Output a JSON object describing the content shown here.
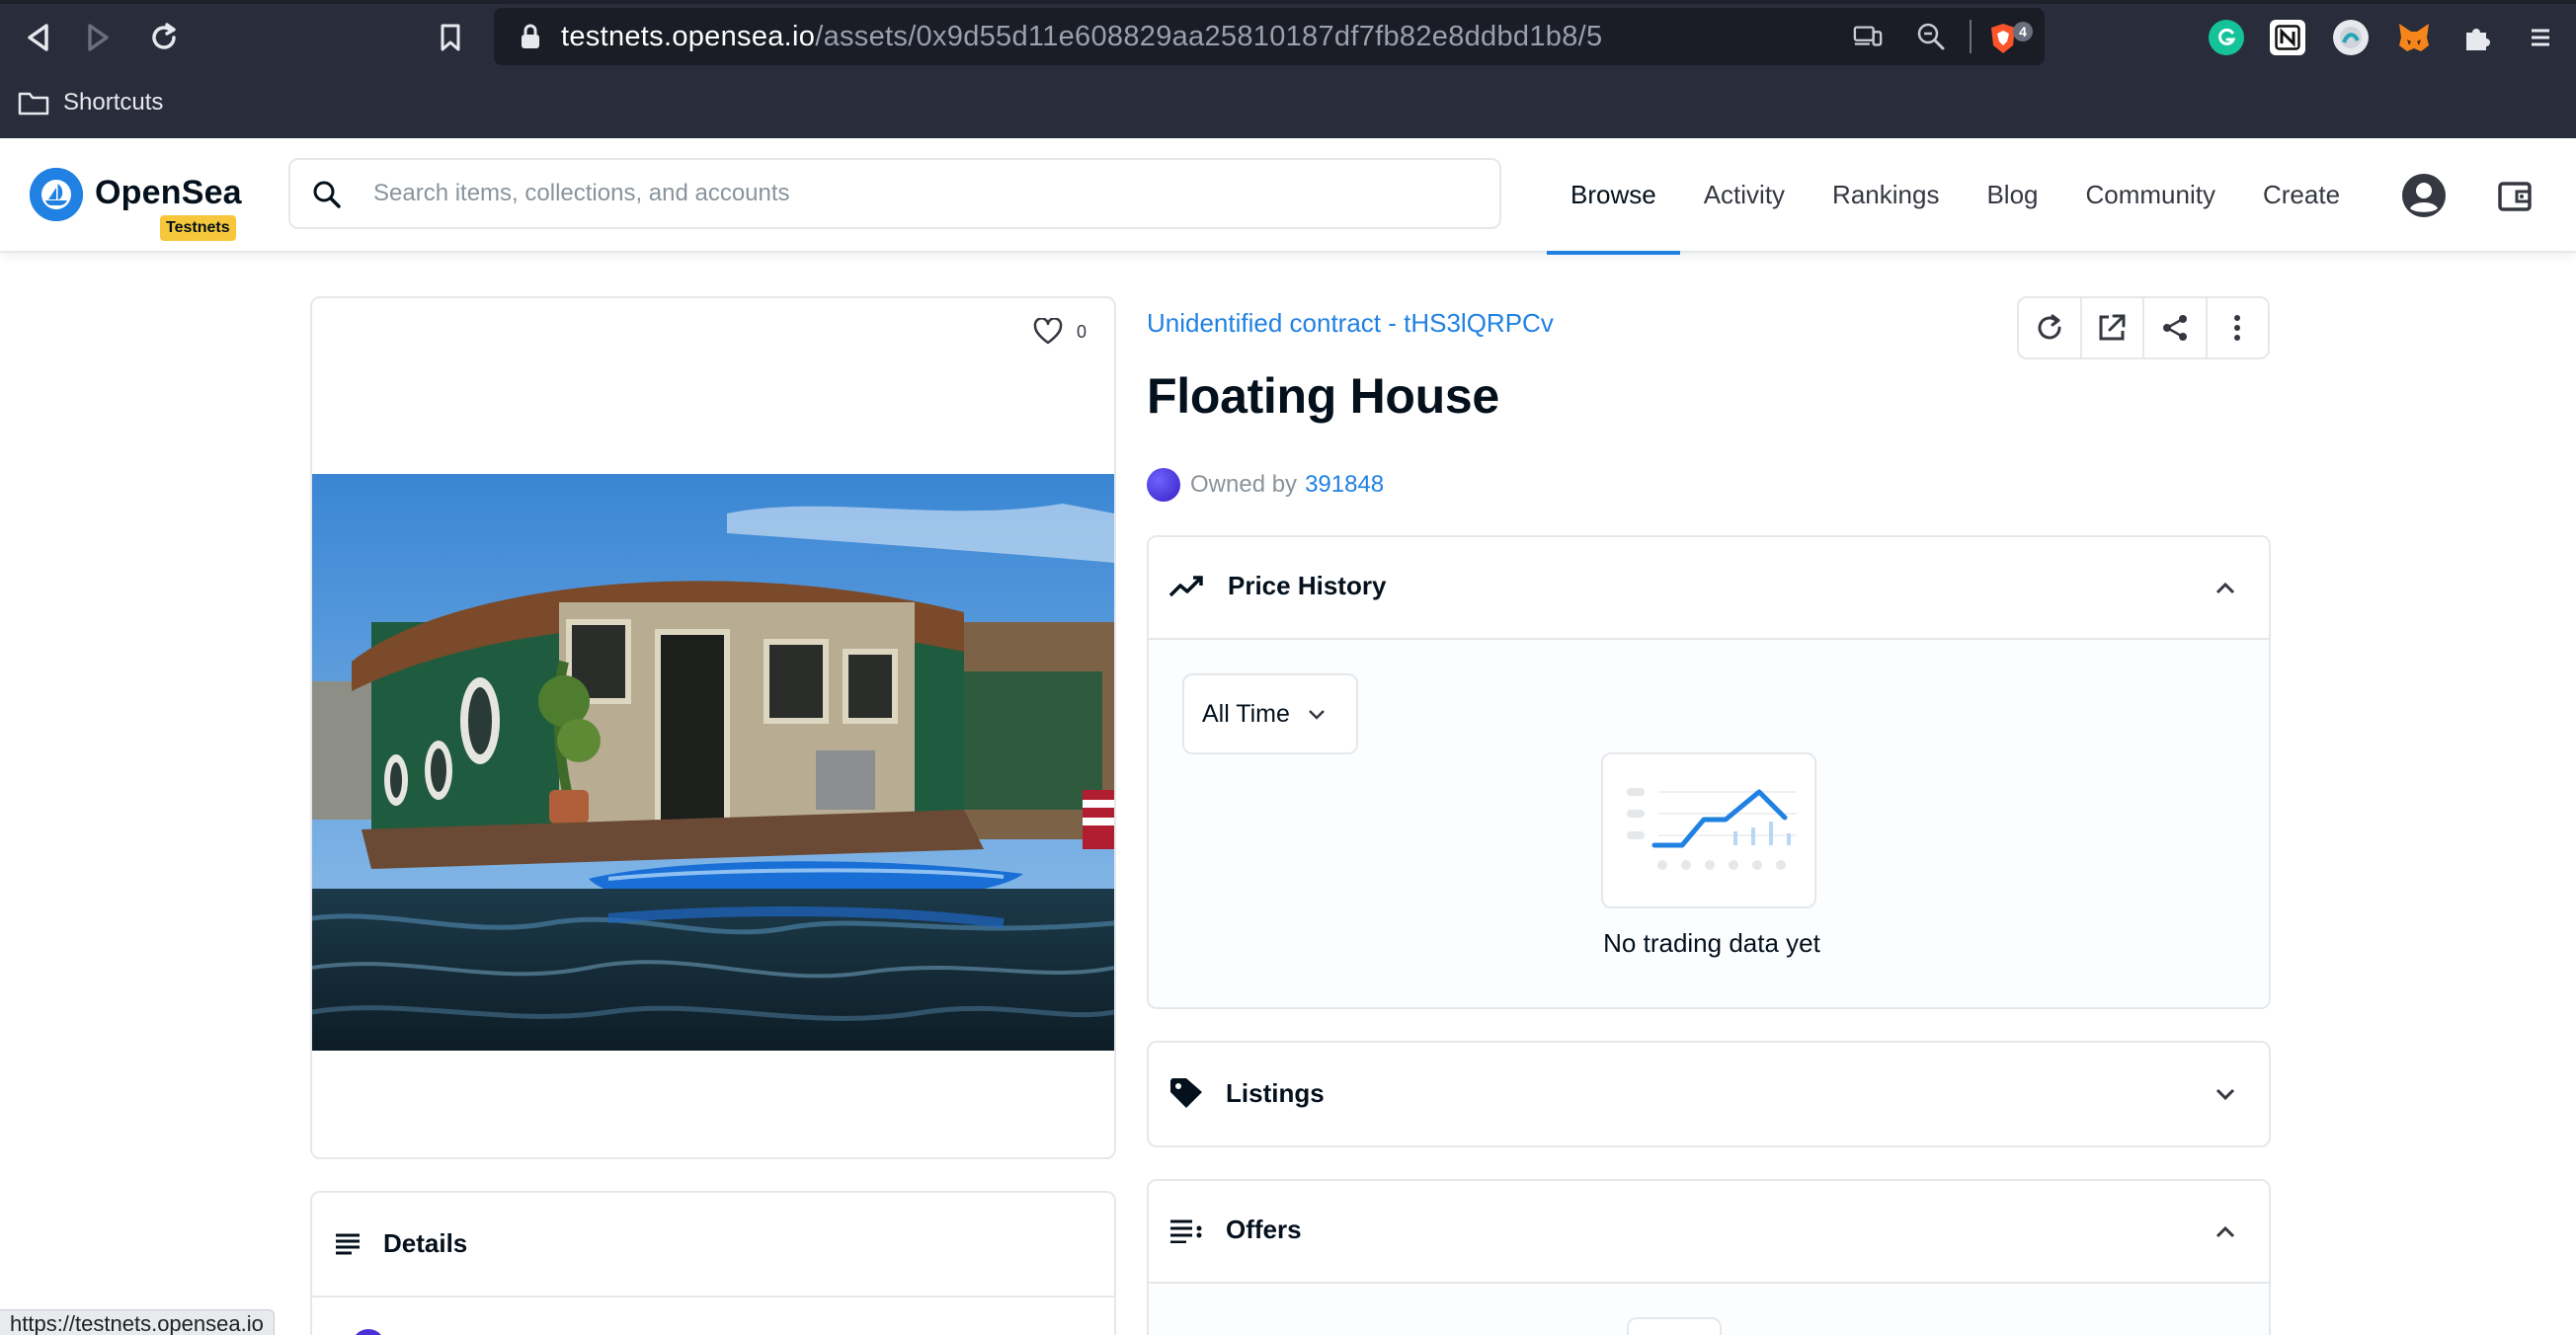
{
  "browser": {
    "url_host": "testnets.opensea.io",
    "url_path": "/assets/0x9d55d11e608829aa25810187df7fb82e8ddbd1b8/5",
    "brave_shield_count": "4",
    "bookmarks_folder": "Shortcuts",
    "status_url": "https://testnets.opensea.io",
    "icons": [
      "back-icon",
      "forward-icon",
      "reload-icon",
      "bookmark-icon",
      "lock-icon",
      "cast-icon",
      "zoom-icon",
      "brave-shield-icon",
      "grammarly-icon",
      "notion-icon",
      "extension-icon",
      "metamask-icon",
      "puzzle-icon",
      "menu-icon",
      "folder-icon"
    ]
  },
  "header": {
    "brand": "OpenSea",
    "badge": "Testnets",
    "search_placeholder": "Search items, collections, and accounts",
    "nav": [
      "Browse",
      "Activity",
      "Rankings",
      "Blog",
      "Community",
      "Create"
    ],
    "active_nav": "Browse",
    "accent": "#2081e2"
  },
  "asset": {
    "favorites": "0",
    "collection": "Unidentified contract - tHS3lQRPCv",
    "title": "Floating House",
    "owned_by_label": "Owned by",
    "owner": "391848"
  },
  "panels": {
    "details": "Details",
    "price_history": "Price History",
    "time_filter": "All Time",
    "no_data": "No trading data yet",
    "listings": "Listings",
    "offers": "Offers"
  }
}
